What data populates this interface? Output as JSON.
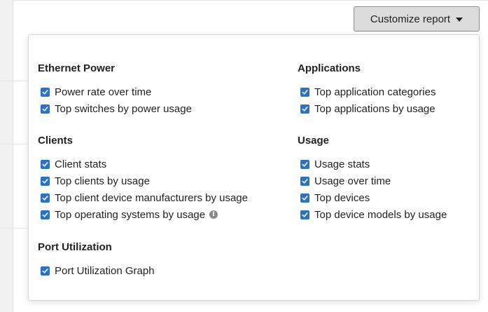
{
  "toolbar": {
    "customize_label": "Customize report"
  },
  "panel": {
    "left_sections": [
      {
        "title": "Ethernet Power",
        "options": [
          {
            "label": "Power rate over time",
            "checked": true
          },
          {
            "label": "Top switches by power usage",
            "checked": true
          }
        ]
      },
      {
        "title": "Clients",
        "options": [
          {
            "label": "Client stats",
            "checked": true
          },
          {
            "label": "Top clients by usage",
            "checked": true
          },
          {
            "label": "Top client device manufacturers by usage",
            "checked": true
          },
          {
            "label": "Top operating systems by usage",
            "checked": true,
            "info_icon": "info-icon"
          }
        ]
      },
      {
        "title": "Port Utilization",
        "options": [
          {
            "label": "Port Utilization Graph",
            "checked": true
          }
        ]
      }
    ],
    "right_sections": [
      {
        "title": "Applications",
        "options": [
          {
            "label": "Top application categories",
            "checked": true
          },
          {
            "label": "Top applications by usage",
            "checked": true
          }
        ]
      },
      {
        "title": "Usage",
        "options": [
          {
            "label": "Usage stats",
            "checked": true
          },
          {
            "label": "Usage over time",
            "checked": true
          },
          {
            "label": "Top devices",
            "checked": true
          },
          {
            "label": "Top device models by usage",
            "checked": true
          }
        ]
      }
    ]
  },
  "colors": {
    "checkbox": "#2a72c8",
    "button_bg": "#dcdcdc"
  }
}
